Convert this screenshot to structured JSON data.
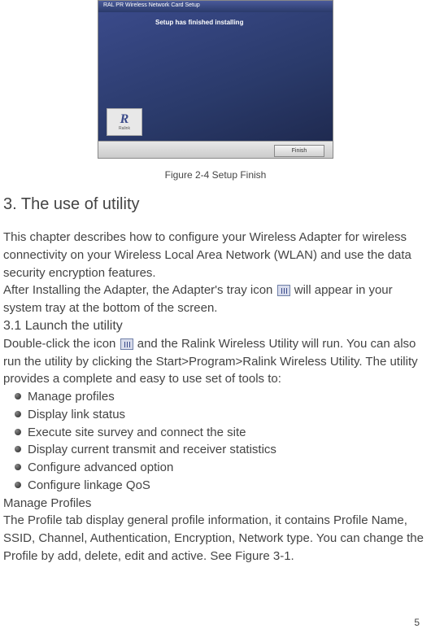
{
  "figure": {
    "titlebar": "RAL PR  Wireless Network Card Setup",
    "body_header": "Setup has finished installing",
    "body_sub": "",
    "body_mid": "",
    "logo_letter": "R",
    "logo_text": "Ralink",
    "finish_btn": "Finish",
    "caption": "Figure 2-4 Setup Finish"
  },
  "section3": {
    "heading": "3. The use of utility",
    "para1a": "This chapter describes how to configure your Wireless Adapter for wireless connectivity on your Wireless Local Area Network (WLAN) and use the data security encryption features.",
    "para1b_pre": "After Installing the Adapter, the Adapter's tray icon ",
    "para1b_post": " will appear in your system tray at the bottom of the screen.",
    "sub31": "3.1 Launch the utility",
    "para2_pre": "Double-click the icon ",
    "para2_post": " and the Ralink Wireless Utility will run. You can also run the utility by clicking the Start>Program>Ralink Wireless Utility. The utility provides a complete and easy to use set of tools to:",
    "bullets": [
      "Manage profiles",
      "Display link status",
      "Execute site survey and connect the site",
      "Display current transmit and receiver statistics",
      "Configure advanced option",
      "Configure linkage QoS"
    ],
    "manage_profiles_label": " Manage Profiles",
    "para3": "The Profile tab display general profile information, it contains Profile Name, SSID, Channel, Authentication, Encryption, Network type. You can change the Profile by add, delete, edit and active. See Figure 3-1."
  },
  "page_number": "5"
}
